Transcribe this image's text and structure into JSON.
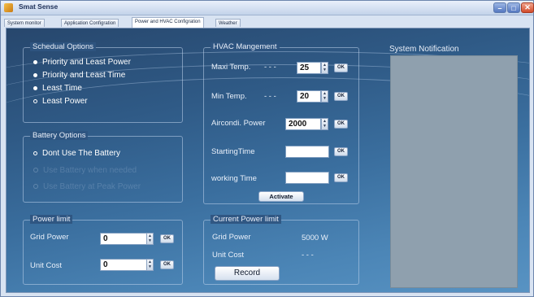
{
  "window": {
    "title": "Smat Sense"
  },
  "tabs": [
    {
      "label": "System monitor"
    },
    {
      "label": "Application Configration"
    },
    {
      "label": "Power and HVAC Configration"
    },
    {
      "label": "Weather"
    }
  ],
  "schedual": {
    "legend": "Schedual Options",
    "options": [
      {
        "label": "Priority and Least Power"
      },
      {
        "label": "Priority and Least Time"
      },
      {
        "label": "Least Time"
      },
      {
        "label": "Least Power"
      }
    ]
  },
  "battery": {
    "legend": "Battery Options",
    "options": [
      {
        "label": "Dont Use The Battery"
      },
      {
        "label": "Use Battery when needed"
      },
      {
        "label": "Use Battery at Peak Power"
      }
    ]
  },
  "power_limit": {
    "legend": "Power limit",
    "grid_power_label": "Grid Power",
    "grid_power_value": "0",
    "unit_cost_label": "Unit Cost",
    "unit_cost_value": "0",
    "ok_label": "OK"
  },
  "hvac": {
    "legend": "HVAC Mangement",
    "max_temp_label": "Maxi Temp.",
    "max_temp_dash": "- - -",
    "max_temp_value": "25",
    "min_temp_label": "Min Temp.",
    "min_temp_dash": "- - -",
    "min_temp_value": "20",
    "aircondi_label": "Aircondi. Power",
    "aircondi_value": "2000",
    "starting_time_label": "StartingTime",
    "starting_time_value": "",
    "working_time_label": "working Time",
    "working_time_value": "",
    "ok_label": "OK",
    "activate_label": "Activate"
  },
  "current_power": {
    "legend": "Current Power limit",
    "grid_power_label": "Grid Power",
    "grid_power_value": "5000 W",
    "unit_cost_label": "Unit Cost",
    "unit_cost_value": "- - -",
    "record_label": "Record"
  },
  "notification": {
    "title": "System Notification"
  }
}
